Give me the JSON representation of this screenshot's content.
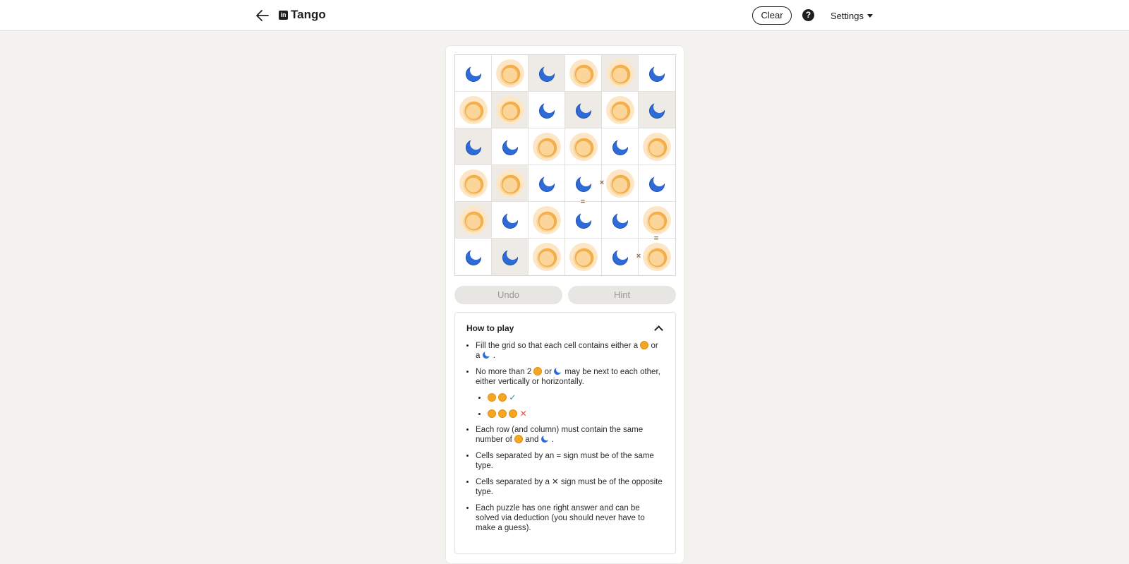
{
  "header": {
    "title": "Tango",
    "logo_text": "in",
    "clear_label": "Clear",
    "help_label": "?",
    "settings_label": "Settings"
  },
  "grid": {
    "rows": [
      [
        "moon",
        "sun",
        "moon",
        "sun",
        "sun",
        "moon"
      ],
      [
        "sun",
        "sun",
        "moon",
        "moon",
        "sun",
        "moon"
      ],
      [
        "moon",
        "moon",
        "sun",
        "sun",
        "moon",
        "sun"
      ],
      [
        "sun",
        "sun",
        "moon",
        "moon",
        "sun",
        "moon"
      ],
      [
        "sun",
        "moon",
        "sun",
        "moon",
        "moon",
        "sun"
      ],
      [
        "moon",
        "moon",
        "sun",
        "sun",
        "moon",
        "sun"
      ]
    ],
    "locked": [
      [
        0,
        0,
        1,
        0,
        1,
        0
      ],
      [
        0,
        1,
        0,
        1,
        0,
        1
      ],
      [
        1,
        0,
        0,
        0,
        0,
        0
      ],
      [
        0,
        1,
        0,
        0,
        0,
        0
      ],
      [
        1,
        0,
        0,
        0,
        0,
        0
      ],
      [
        0,
        1,
        0,
        0,
        0,
        0
      ]
    ],
    "signs": [
      {
        "row": 3,
        "col": 3,
        "edge": "right",
        "symbol": "×"
      },
      {
        "row": 3,
        "col": 3,
        "edge": "bottom",
        "symbol": "="
      },
      {
        "row": 4,
        "col": 5,
        "edge": "bottom",
        "symbol": "="
      },
      {
        "row": 5,
        "col": 4,
        "edge": "right",
        "symbol": "×"
      }
    ]
  },
  "actions": {
    "undo_label": "Undo",
    "hint_label": "Hint"
  },
  "how_to_play": {
    "title": "How to play",
    "rule1_a": "Fill the grid so that each cell contains either a",
    "rule1_b": "or",
    "rule1_c": "a",
    "rule1_d": ".",
    "rule2_a": "No more than 2",
    "rule2_b": "or",
    "rule2_c": "may be next to each other, either vertically or horizontally.",
    "example_ok_mark": "✓",
    "example_bad_mark": "✕",
    "rule3_a": "Each row (and column) must contain the same number of",
    "rule3_b": "and",
    "rule3_c": ".",
    "rule4": "Cells separated by an = sign must be of the same type.",
    "rule5_a": "Cells separated by a",
    "rule5_symbol": "✕",
    "rule5_b": "sign must be of the opposite type.",
    "rule6": "Each puzzle has one right answer and can be solved via deduction (you should never have to make a guess)."
  },
  "colors": {
    "sun": "#f5a623",
    "moon": "#2e6bd6",
    "locked_cell": "#eeebe7",
    "background": "#f4f2ee"
  }
}
